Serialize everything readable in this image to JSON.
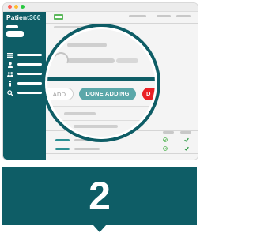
{
  "app": {
    "logo_text": "Patient",
    "logo_number": "360"
  },
  "sidebar": {
    "items": [
      {
        "icon": "list-icon"
      },
      {
        "icon": "user-icon"
      },
      {
        "icon": "users-icon"
      },
      {
        "icon": "info-icon"
      },
      {
        "icon": "search-icon"
      }
    ]
  },
  "magnifier": {
    "add_label": "ADD",
    "done_adding_label": "DONE ADDING",
    "red_button_label": "D"
  },
  "step": {
    "number": "2"
  },
  "colors": {
    "brand_teal": "#0e5d66",
    "button_teal": "#5aa7a9",
    "danger_red": "#ea1f25",
    "check_green": "#5cb85c"
  }
}
